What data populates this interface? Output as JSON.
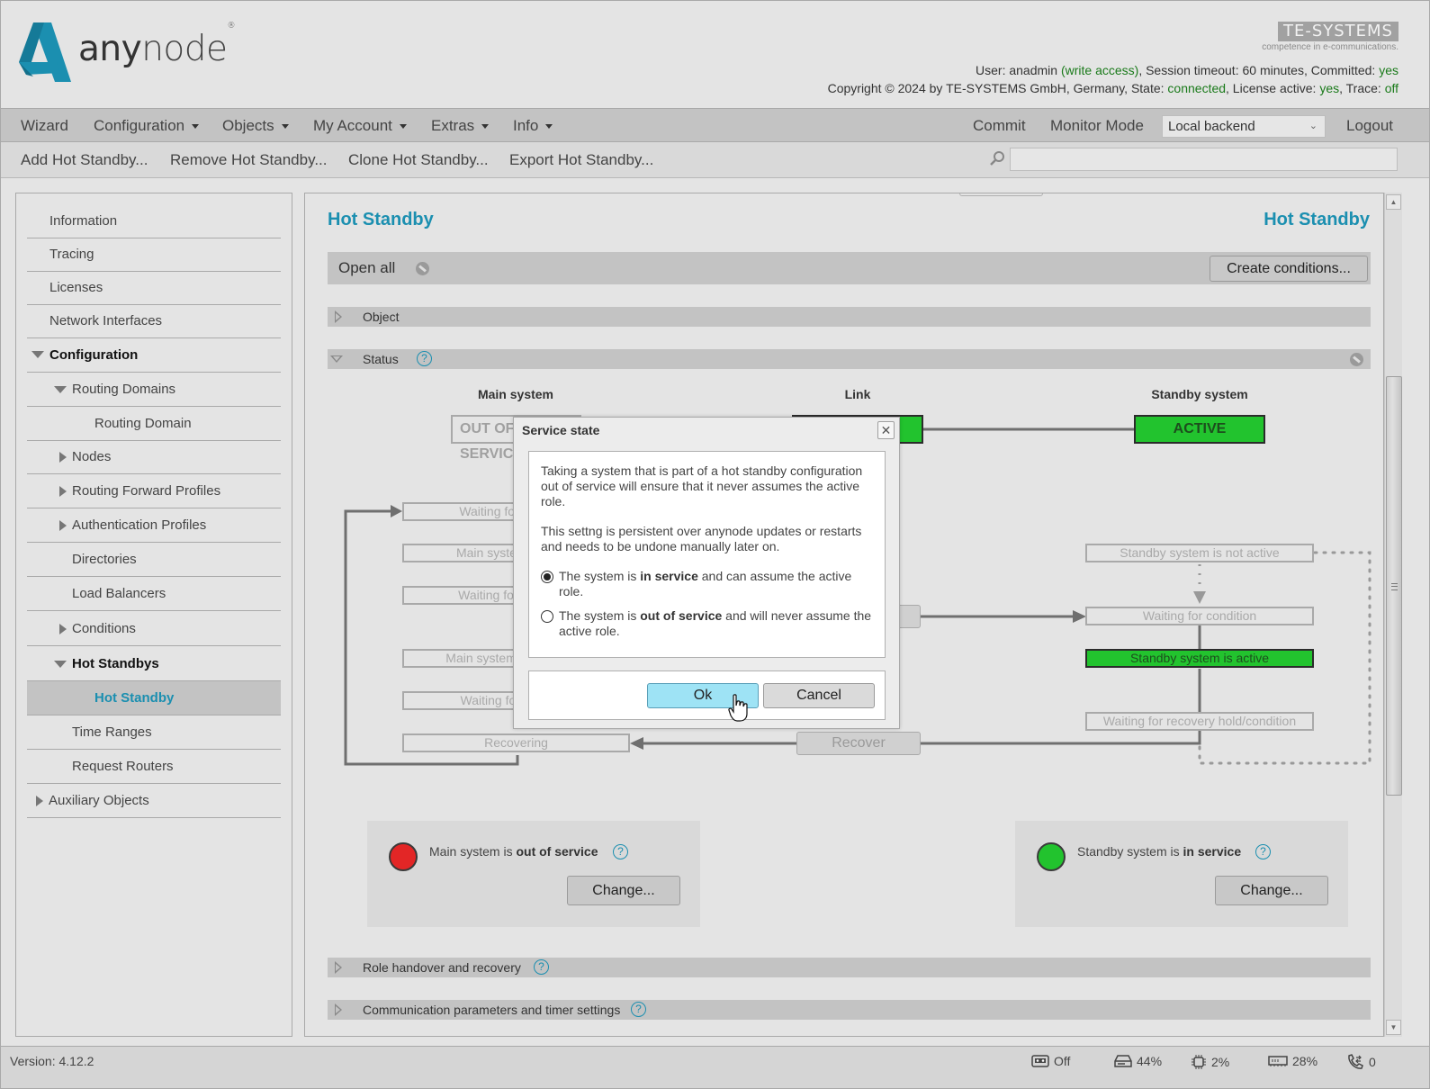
{
  "header": {
    "logo_text_bold": "any",
    "logo_text_light": "node",
    "logo_reg": "®",
    "vendor_logo": "TE-SYSTEMS",
    "vendor_tagline": "competence in e-communications.",
    "user_prefix": "User: anadmin ",
    "user_access": "(write access)",
    "user_session": ", Session timeout: 60 minutes, Committed: ",
    "committed": "yes",
    "copyright": "Copyright © 2024 by TE-SYSTEMS GmbH, Germany, State: ",
    "state": "connected",
    "license_prefix": ", License active: ",
    "license_active": "yes",
    "trace_prefix": ", Trace: ",
    "trace": "off"
  },
  "navbar": {
    "items": [
      {
        "label": "Wizard",
        "dropdown": false
      },
      {
        "label": "Configuration",
        "dropdown": true
      },
      {
        "label": "Objects",
        "dropdown": true
      },
      {
        "label": "My Account",
        "dropdown": true
      },
      {
        "label": "Extras",
        "dropdown": true
      },
      {
        "label": "Info",
        "dropdown": true
      }
    ],
    "commit": "Commit",
    "monitor_mode": "Monitor Mode",
    "backend_selected": "Local backend",
    "logout": "Logout"
  },
  "toolbar": {
    "add": "Add Hot Standby...",
    "remove": "Remove Hot Standby...",
    "clone": "Clone Hot Standby...",
    "export": "Export Hot Standby...",
    "search_placeholder": ""
  },
  "sidebar": {
    "items": [
      {
        "label": "Information"
      },
      {
        "label": "Tracing"
      },
      {
        "label": "Licenses"
      },
      {
        "label": "Network Interfaces"
      },
      {
        "label": "Configuration",
        "expanded": true
      },
      {
        "label": "Routing Domains",
        "expanded": true
      },
      {
        "label": "Routing Domain"
      },
      {
        "label": "Nodes",
        "expanded": false
      },
      {
        "label": "Routing Forward Profiles",
        "expanded": false
      },
      {
        "label": "Authentication Profiles",
        "expanded": false
      },
      {
        "label": "Directories"
      },
      {
        "label": "Load Balancers"
      },
      {
        "label": "Conditions",
        "expanded": false
      },
      {
        "label": "Hot Standbys",
        "expanded": true
      },
      {
        "label": "Hot Standby",
        "selected": true
      },
      {
        "label": "Time Ranges"
      },
      {
        "label": "Request Routers"
      },
      {
        "label": "Auxiliary Objects",
        "expanded": false
      }
    ]
  },
  "content": {
    "title_left": "Hot Standby",
    "title_right": "Hot Standby",
    "open_all": "Open all",
    "create_conditions": "Create conditions...",
    "sections": {
      "object": "Object",
      "status": "Status",
      "role_handover": "Role handover and recovery",
      "comm_params": "Communication parameters and timer settings"
    },
    "diagram": {
      "main_head": "Main system",
      "link_head": "Link",
      "standby_head": "Standby system",
      "main_state": "OUT OF SERVICE",
      "link_state": "",
      "standby_state": "ACTIVE",
      "main_states": [
        "Waiting for condition",
        "Main system is active",
        "Waiting for handover",
        "Main system is not active",
        "Waiting for recovery",
        "Recovering"
      ],
      "standby_states": [
        "Standby system is not active",
        "Waiting for condition",
        "Standby system is active",
        "Waiting for recovery hold/condition"
      ],
      "standby_active_index": 2,
      "recover_btn": "Recover"
    },
    "main_service": {
      "prefix": "Main system is ",
      "state": "out of service",
      "color": "#e32626",
      "change": "Change..."
    },
    "standby_service": {
      "prefix": "Standby system is ",
      "state": "in service",
      "color": "#22c32e",
      "change": "Change..."
    }
  },
  "modal": {
    "title": "Service state",
    "para1": "Taking a system that is part of a hot standby configuration out of service will ensure that it never assumes the active role.",
    "para2": "This settng is persistent over anynode updates or restarts and needs to be undone manually later on.",
    "option_in_prefix": "The system is ",
    "option_in_bold": "in service",
    "option_in_suffix": " and can assume the active role.",
    "option_out_prefix": "The system is ",
    "option_out_bold": "out of service",
    "option_out_suffix": " and will never assume the active role.",
    "selected": "in service",
    "ok": "Ok",
    "cancel": "Cancel"
  },
  "statusbar": {
    "version_label": "Version:",
    "version": "4.12.2",
    "trace": "Off",
    "disk": "44%",
    "cpu": "2%",
    "memory": "28%",
    "calls": "0"
  }
}
